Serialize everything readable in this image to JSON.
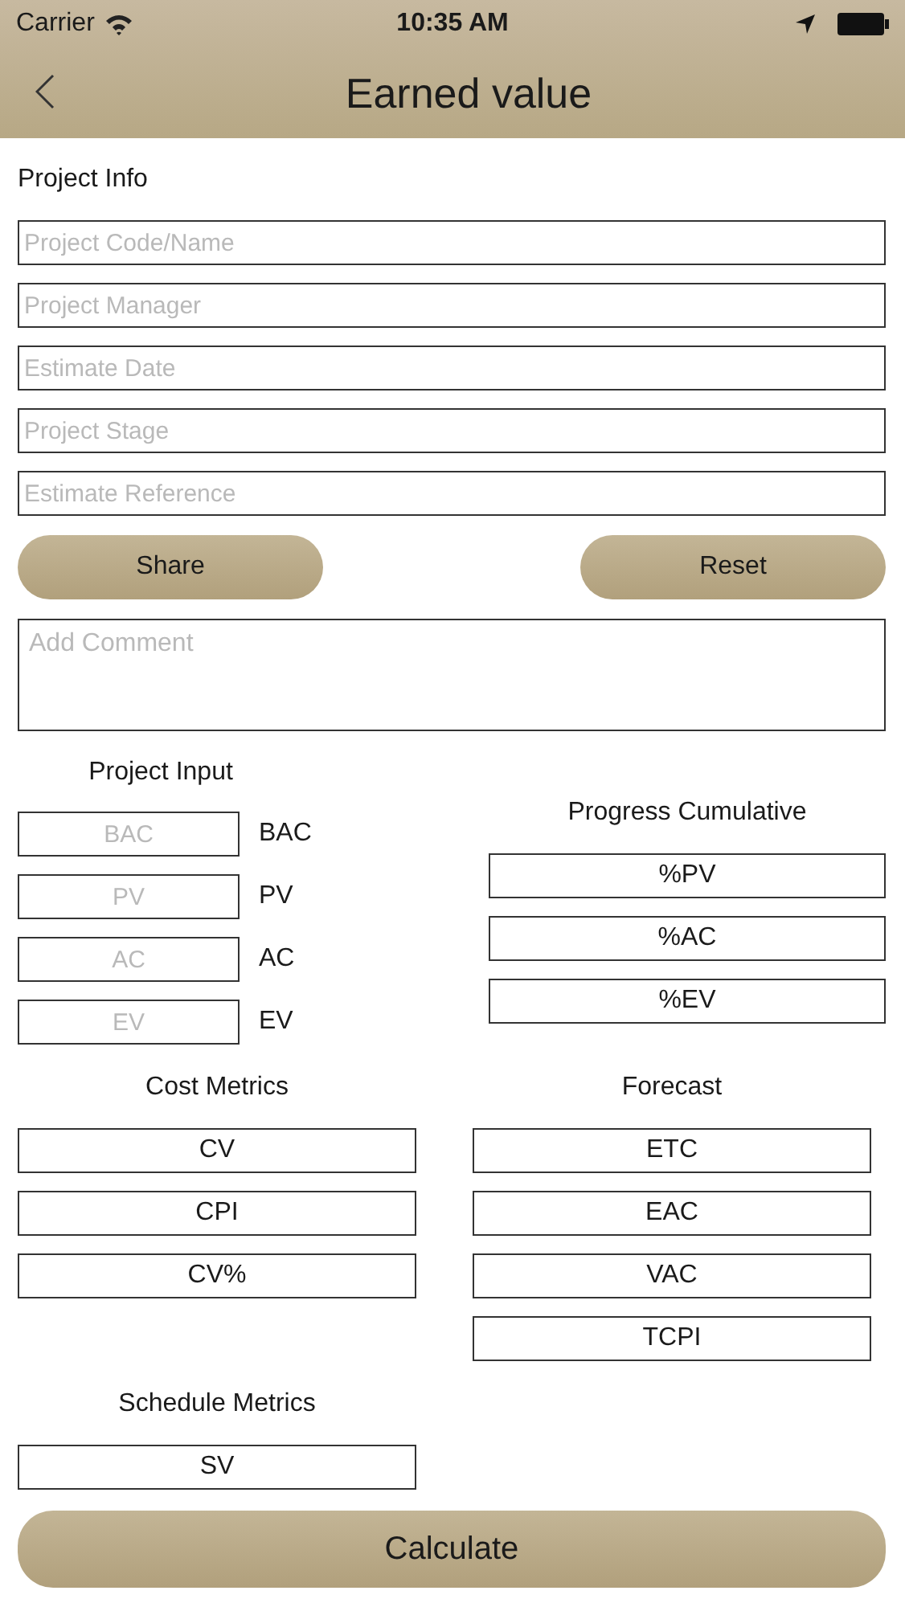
{
  "status_bar": {
    "carrier": "Carrier",
    "time": "10:35 AM"
  },
  "nav": {
    "title": "Earned value"
  },
  "project_info": {
    "title": "Project Info",
    "fields": [
      {
        "placeholder": "Project Code/Name"
      },
      {
        "placeholder": "Project Manager"
      },
      {
        "placeholder": "Estimate Date"
      },
      {
        "placeholder": "Project Stage"
      },
      {
        "placeholder": "Estimate Reference"
      }
    ]
  },
  "buttons": [
    {
      "label": "Share"
    },
    {
      "label": "Reset"
    }
  ],
  "comment": {
    "placeholder": "Add Comment"
  },
  "project_input": {
    "title": "Project Input",
    "rows": [
      {
        "placeholder": "BAC",
        "label": "BAC"
      },
      {
        "placeholder": "PV",
        "label": "PV"
      },
      {
        "placeholder": "AC",
        "label": "AC"
      },
      {
        "placeholder": "EV",
        "label": "EV"
      }
    ]
  },
  "progress": {
    "title": "Progress Cumulative",
    "fields": [
      "%PV",
      "%AC",
      "%EV"
    ]
  },
  "cost_metrics": {
    "title": "Cost Metrics",
    "fields": [
      "CV",
      "CPI",
      "CV%"
    ]
  },
  "schedule_metrics": {
    "title": "Schedule Metrics",
    "fields": [
      "SV"
    ]
  },
  "forecast": {
    "title": "Forecast",
    "fields": [
      "ETC",
      "EAC",
      "VAC",
      "TCPI"
    ]
  },
  "calculate": {
    "label": "Calculate"
  }
}
